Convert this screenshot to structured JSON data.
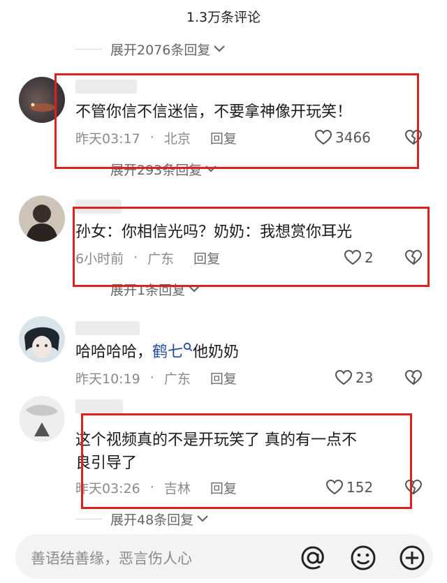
{
  "header": {
    "title": "1.3万条评论"
  },
  "replies_toggles": [
    {
      "label": "展开2076条回复"
    },
    {
      "label": "展开293条回复"
    },
    {
      "label": "展开1条回复"
    },
    {
      "label": "展开48条回复"
    }
  ],
  "comments": [
    {
      "text": "不管你信不信迷信，不要拿神像开玩笑！",
      "time": "昨天03:17",
      "location": "北京",
      "reply_label": "回复",
      "likes": "3466"
    },
    {
      "text": "孙女：你相信光吗？奶奶：我想赏你耳光",
      "time": "6小时前",
      "location": "广东",
      "reply_label": "回复",
      "likes": "2"
    },
    {
      "text_before": "哈哈哈哈，",
      "mention": "鹤七",
      "text_after": "他奶奶",
      "time": "昨天10:19",
      "location": "广东",
      "reply_label": "回复",
      "likes": "23"
    },
    {
      "text_line1": "这个视频真的不是开玩笑了 真的有一点不",
      "text_line2": "良引导了",
      "time": "昨天03:26",
      "location": "吉林",
      "reply_label": "回复",
      "likes": "152"
    }
  ],
  "input": {
    "placeholder": "善语结善缘，恶言伤人心"
  },
  "icons": {
    "mention": "at-icon",
    "emoji": "smiley-icon",
    "add": "plus-circle-icon",
    "like": "heart-icon",
    "dislike": "broken-heart-icon"
  },
  "colors": {
    "highlight": "#e0201e",
    "mention": "#1f4e9a"
  }
}
